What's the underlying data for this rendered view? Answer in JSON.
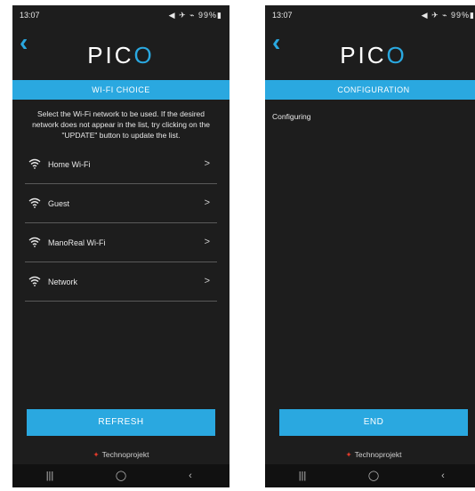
{
  "left_screen": {
    "status_time": "13:07",
    "status_icons": "◀ ✈ ⌁ 99%▮",
    "logo_main": "PIC",
    "logo_accent": "O",
    "banner": "WI-FI CHOICE",
    "instructions": "Select the Wi-Fi network to be used. If the desired network does not appear in the list, try clicking on the \"UPDATE\" button to update the list.",
    "networks": [
      {
        "name": "Home Wi-Fi"
      },
      {
        "name": "Guest"
      },
      {
        "name": "ManoReal Wi-Fi"
      },
      {
        "name": "Network"
      }
    ],
    "button": "REFRESH",
    "footer_brand": "Technoprojekt"
  },
  "right_screen": {
    "status_time": "13:07",
    "status_icons": "◀ ✈ ⌁ 99%▮",
    "logo_main": "PIC",
    "logo_accent": "O",
    "banner": "CONFIGURATION",
    "status_text": "Configuring",
    "button": "END",
    "footer_brand": "Technoprojekt"
  },
  "nav": {
    "recent": "|||",
    "home": "◯",
    "back": "‹"
  },
  "colors": {
    "accent": "#2aa8e0",
    "background": "#1d1d1d",
    "brand_red": "#e03a2a"
  },
  "icons": {
    "wifi": "wifi-icon",
    "back": "back-arrow-icon",
    "chevron": "chevron-right-icon"
  }
}
